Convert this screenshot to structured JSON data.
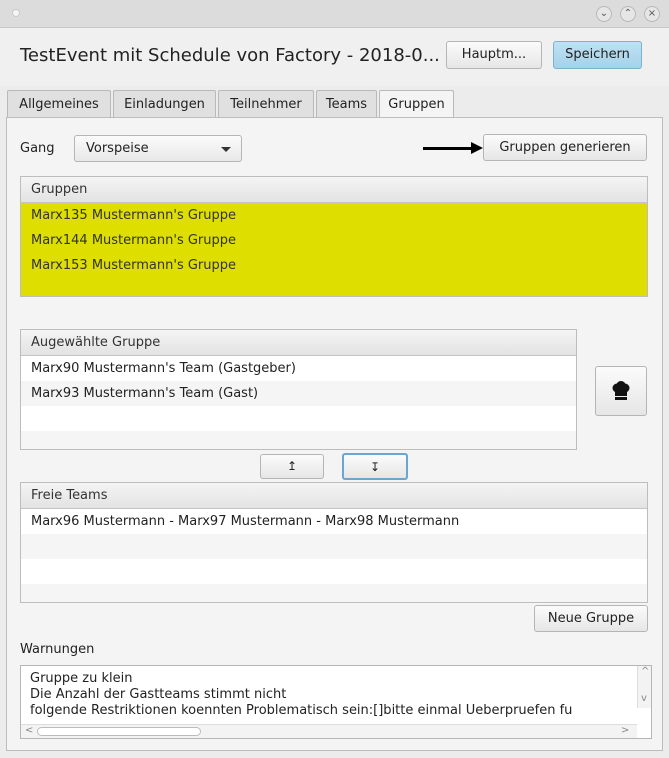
{
  "window": {
    "title": "TestEvent mit Schedule von Factory - 2018-0...",
    "minimize_glyph": "⌄",
    "maximize_glyph": "⌃",
    "close_glyph": "×"
  },
  "header": {
    "main_menu_label": "Hauptm...",
    "save_label": "Speichern"
  },
  "tabs": [
    {
      "label": "Allgemeines",
      "active": false
    },
    {
      "label": "Einladungen",
      "active": false
    },
    {
      "label": "Teilnehmer",
      "active": false
    },
    {
      "label": "Teams",
      "active": false
    },
    {
      "label": "Gruppen",
      "active": true
    }
  ],
  "controls": {
    "course_label": "Gang",
    "course_value": "Vorspeise",
    "generate_label": "Gruppen generieren",
    "arrow_icon": "right-arrow"
  },
  "groups": {
    "header": "Gruppen",
    "highlight_color": "#dede00",
    "items": [
      "Marx135 Mustermann's Gruppe",
      "Marx144 Mustermann's Gruppe",
      "Marx153 Mustermann's Gruppe"
    ]
  },
  "selected_group": {
    "header": "Augewählte Gruppe",
    "items": [
      "Marx90 Mustermann's Team (Gastgeber)",
      "Marx93 Mustermann's Team (Gast)"
    ],
    "host_icon": "chef-hat-icon",
    "move_up_glyph": "↥",
    "move_down_glyph": "↧"
  },
  "free_teams": {
    "header": "Freie Teams",
    "items": [
      "Marx96 Mustermann - Marx97 Mustermann - Marx98 Mustermann"
    ],
    "new_group_label": "Neue Gruppe"
  },
  "warnings": {
    "label": "Warnungen",
    "lines": [
      "Gruppe zu klein",
      "Die Anzahl der Gastteams stimmt nicht",
      "folgende Restriktionen koennten Problematisch sein:[]bitte einmal Ueberpruefen fu"
    ]
  }
}
